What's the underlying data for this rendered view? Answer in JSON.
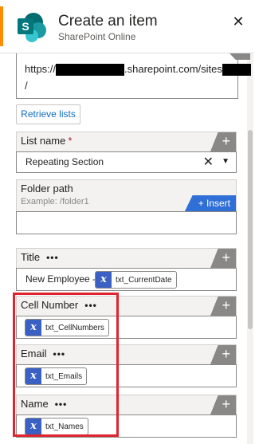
{
  "header": {
    "title": "Create an item",
    "subtitle": "SharePoint Online",
    "logo_letter": "S",
    "close_symbol": "✕",
    "accent_color": "#ff8c00"
  },
  "site_url": {
    "prefix": "https://",
    "middle": ".sharepoint.com/sites",
    "suffix": "/"
  },
  "retrieve_button": "Retrieve lists",
  "list_name": {
    "label": "List name",
    "required_mark": "*",
    "value": "Repeating Section",
    "clear_symbol": "✕",
    "dropdown_symbol": "▼"
  },
  "folder_path": {
    "label": "Folder path",
    "hint": "Example: /folder1",
    "insert_label": "+ Insert"
  },
  "title_field": {
    "label": "Title",
    "menu": "•••",
    "prefix_text": "New Employee -",
    "token": "txt_CurrentDate"
  },
  "cell_number": {
    "label": "Cell Number",
    "menu": "•••",
    "token": "txt_CellNumbers"
  },
  "email": {
    "label": "Email",
    "menu": "•••",
    "token": "txt_Emails"
  },
  "name": {
    "label": "Name",
    "menu": "•••",
    "token": "txt_Names"
  },
  "plus_symbol": "+",
  "fx_symbol": "x",
  "colors": {
    "token_icon": "#3b60c4",
    "insert_button": "#2f6fd6",
    "highlight_border": "#e0242f",
    "link_blue": "#0f6cbd"
  }
}
